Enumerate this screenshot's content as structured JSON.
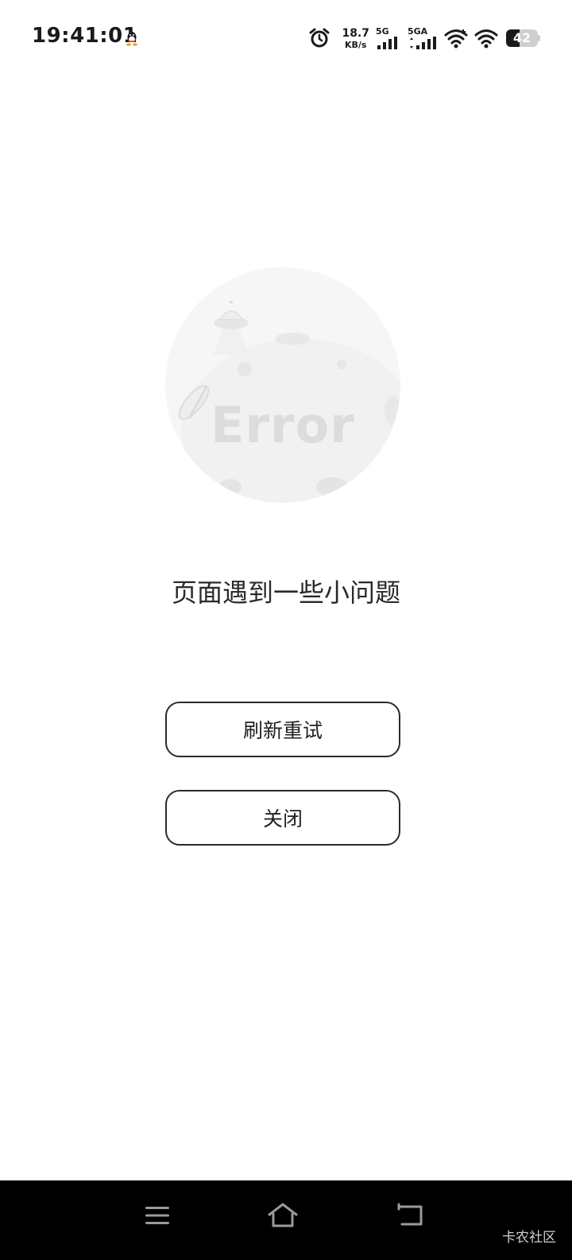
{
  "status_bar": {
    "time": "19:41:01",
    "net_speed_value": "18.7",
    "net_speed_unit": "KB/s",
    "signal1_label": "5G",
    "signal2_label": "5GA",
    "battery_level": "42",
    "battery_fraction": 0.42
  },
  "error_page": {
    "illustration_text": "Error",
    "message": "页面遇到一些小问题",
    "retry_label": "刷新重试",
    "close_label": "关闭"
  },
  "watermark": "卡农社区",
  "icons": {
    "status": [
      "qq-icon",
      "alarm-icon",
      "signal-icon",
      "wifi-icon",
      "battery-icon"
    ],
    "nav": [
      "menu-icon",
      "home-icon",
      "back-icon"
    ]
  }
}
